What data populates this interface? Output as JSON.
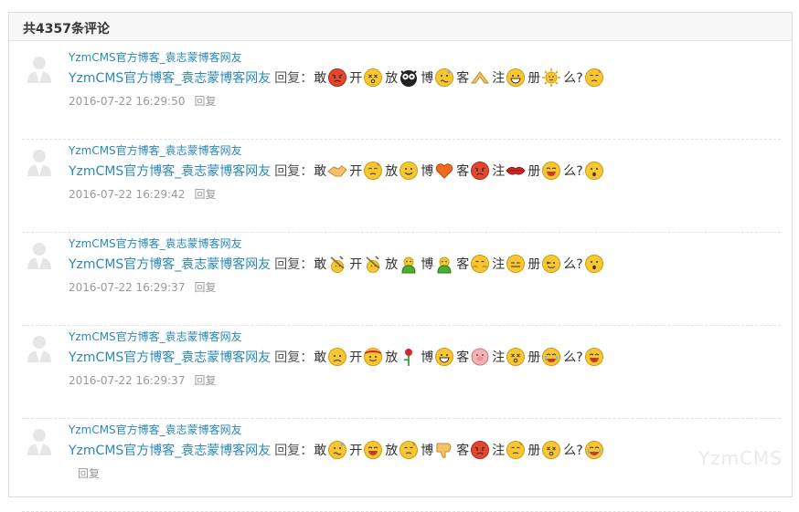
{
  "header": {
    "title": "共4357条评论"
  },
  "watermark": "YzmCMS",
  "labels": {
    "reply_word": "回复",
    "colon": "：",
    "reply_action": "回复"
  },
  "comments": [
    {
      "user": "YzmCMS官方博客_袁志蒙博客网友",
      "reply_to": "YzmCMS官方博客_袁志蒙博客网友",
      "content": [
        {
          "c": "敢",
          "e": "angry"
        },
        {
          "c": "开",
          "e": "dizzy"
        },
        {
          "c": "放",
          "e": "owl"
        },
        {
          "c": "博",
          "e": "confused"
        },
        {
          "c": "客",
          "e": "hands"
        },
        {
          "c": "注",
          "e": "grin"
        },
        {
          "c": "册",
          "e": "sun"
        },
        {
          "c": "么?",
          "e": "puzzled"
        }
      ],
      "time": "2016-07-22 16:29:50"
    },
    {
      "user": "YzmCMS官方博客_袁志蒙博客网友",
      "reply_to": "YzmCMS官方博客_袁志蒙博客网友",
      "content": [
        {
          "c": "敢",
          "e": "handshake"
        },
        {
          "c": "开",
          "e": "puzzled"
        },
        {
          "c": "放",
          "e": "smile"
        },
        {
          "c": "博",
          "e": "heart"
        },
        {
          "c": "客",
          "e": "angry"
        },
        {
          "c": "注",
          "e": "lips"
        },
        {
          "c": "册",
          "e": "laugh"
        },
        {
          "c": "么?",
          "e": "surprised"
        }
      ],
      "time": "2016-07-22 16:29:42"
    },
    {
      "user": "YzmCMS官方博客_袁志蒙博客网友",
      "reply_to": "YzmCMS官方博客_袁志蒙博客网友",
      "content": [
        {
          "c": "敢",
          "e": "pick"
        },
        {
          "c": "开",
          "e": "pick"
        },
        {
          "c": "放",
          "e": "frog"
        },
        {
          "c": "博",
          "e": "frog"
        },
        {
          "c": "客",
          "e": "hug"
        },
        {
          "c": "注",
          "e": "sweat"
        },
        {
          "c": "册",
          "e": "wink"
        },
        {
          "c": "么?",
          "e": "surprised"
        }
      ],
      "time": "2016-07-22 16:29:37"
    },
    {
      "user": "YzmCMS官方博客_袁志蒙博客网友",
      "reply_to": "YzmCMS官方博客_袁志蒙博客网友",
      "content": [
        {
          "c": "敢",
          "e": "sad"
        },
        {
          "c": "开",
          "e": "bandana"
        },
        {
          "c": "放",
          "e": "rose"
        },
        {
          "c": "博",
          "e": "grin"
        },
        {
          "c": "客",
          "e": "pig"
        },
        {
          "c": "注",
          "e": "dizzy"
        },
        {
          "c": "册",
          "e": "cry"
        },
        {
          "c": "么?",
          "e": "laugh"
        }
      ],
      "time": "2016-07-22 16:29:37"
    },
    {
      "user": "YzmCMS官方博客_袁志蒙博客网友",
      "reply_to": "YzmCMS官方博客_袁志蒙博客网友",
      "content": [
        {
          "c": "敢",
          "e": "confused"
        },
        {
          "c": "开",
          "e": "laugh"
        },
        {
          "c": "放",
          "e": "puzzled"
        },
        {
          "c": "博",
          "e": "thumbsdown"
        },
        {
          "c": "客",
          "e": "angry"
        },
        {
          "c": "注",
          "e": "puzzled"
        },
        {
          "c": "册",
          "e": "dizzy"
        },
        {
          "c": "么?",
          "e": "cry"
        }
      ],
      "time": ""
    }
  ],
  "colors": {
    "link": "#2a88b8",
    "meta": "#999999",
    "emoji_face": "#f7c631"
  }
}
